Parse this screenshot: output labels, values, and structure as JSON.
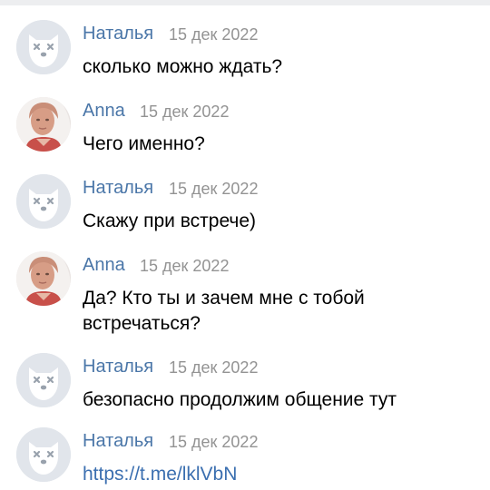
{
  "colors": {
    "name": "#4a76a8",
    "date": "#939393",
    "text": "#000000",
    "link": "#3b6fb0",
    "avatar_default_bg": "#e1e5eb"
  },
  "messages": [
    {
      "author": "Наталья",
      "date": "15 дек 2022",
      "text": "сколько можно ждать?",
      "avatar": "deactivated-dog-icon"
    },
    {
      "author": "Anna",
      "date": "15 дек 2022",
      "text": "Чего именно?",
      "avatar": "user-photo"
    },
    {
      "author": "Наталья",
      "date": "15 дек 2022",
      "text": "Скажу при встрече)",
      "avatar": "deactivated-dog-icon"
    },
    {
      "author": "Anna",
      "date": "15 дек 2022",
      "text": "Да? Кто ты и зачем мне с тобой встречаться?",
      "avatar": "user-photo"
    },
    {
      "author": "Наталья",
      "date": "15 дек 2022",
      "text": "безопасно продолжим общение тут",
      "avatar": "deactivated-dog-icon"
    },
    {
      "author": "Наталья",
      "date": "15 дек 2022",
      "link": "https://t.me/lklVbN",
      "avatar": "deactivated-dog-icon"
    }
  ]
}
